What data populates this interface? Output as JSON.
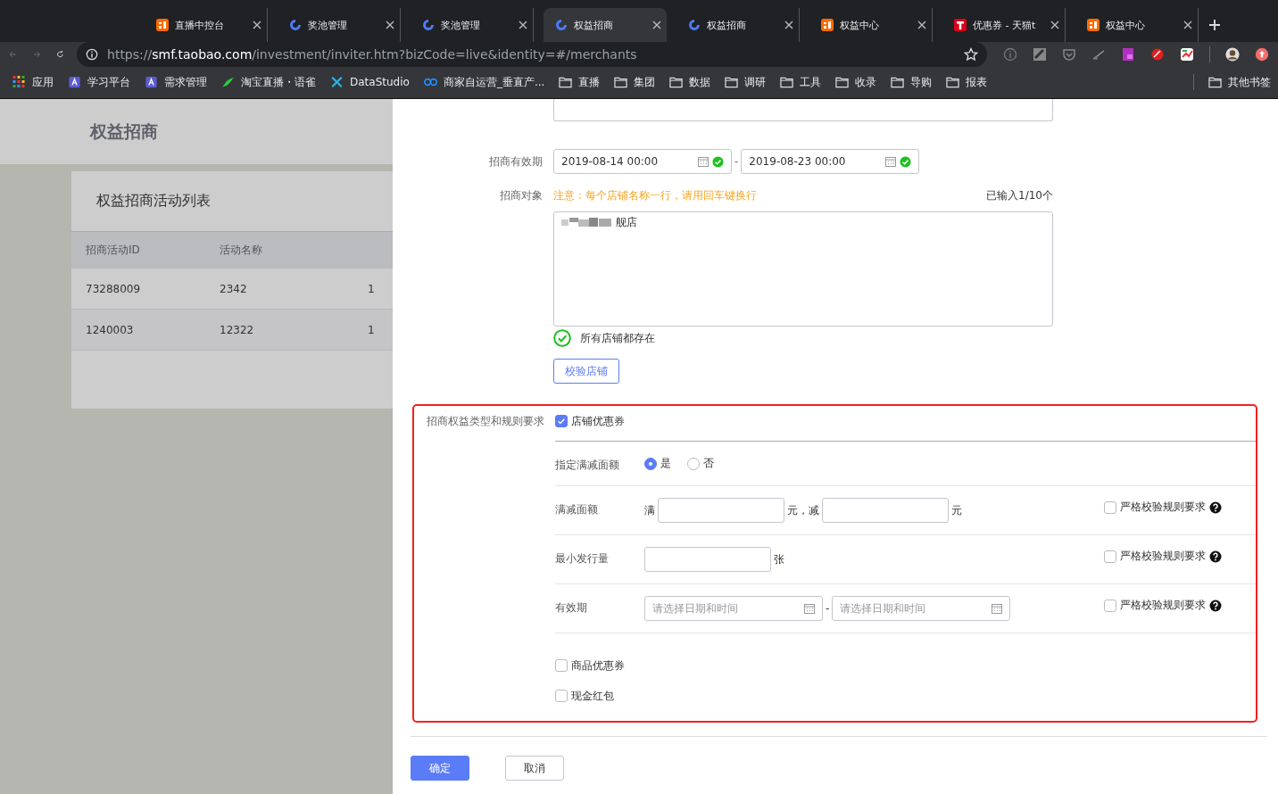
{
  "browser": {
    "tabs": [
      {
        "title": "直播中控台",
        "kind": "orange",
        "selected": false
      },
      {
        "title": "奖池管理",
        "kind": "swirl",
        "selected": false
      },
      {
        "title": "奖池管理",
        "kind": "swirl",
        "selected": false
      },
      {
        "title": "权益招商",
        "kind": "swirl",
        "selected": true
      },
      {
        "title": "权益招商",
        "kind": "swirl",
        "selected": false
      },
      {
        "title": "权益中心",
        "kind": "orange",
        "selected": false
      },
      {
        "title": "优惠券 - 天猫t",
        "kind": "red",
        "selected": false
      },
      {
        "title": "权益中心",
        "kind": "orange",
        "selected": false
      }
    ],
    "url": {
      "scheme": "https://",
      "host": "smf.taobao.com",
      "path": "/investment/inviter.htm?bizCode=live&identity=#/merchants"
    },
    "bookmarks": [
      {
        "label": "应用",
        "kind": "apps"
      },
      {
        "label": "学习平台",
        "kind": "site"
      },
      {
        "label": "需求管理",
        "kind": "site"
      },
      {
        "label": "淘宝直播・语雀",
        "kind": "bird"
      },
      {
        "label": "DataStudio",
        "kind": "tools"
      },
      {
        "label": "商家自运营_垂直产...",
        "kind": "link"
      },
      {
        "label": "直播",
        "kind": "folder"
      },
      {
        "label": "集团",
        "kind": "folder"
      },
      {
        "label": "数据",
        "kind": "folder"
      },
      {
        "label": "调研",
        "kind": "folder"
      },
      {
        "label": "工具",
        "kind": "folder"
      },
      {
        "label": "收录",
        "kind": "folder"
      },
      {
        "label": "导购",
        "kind": "folder"
      },
      {
        "label": "报表",
        "kind": "folder"
      }
    ],
    "other_bookmarks": "其他书签"
  },
  "page": {
    "title": "权益招商",
    "card": {
      "title": "权益招商活动列表",
      "columns": [
        "招商活动ID",
        "活动名称"
      ],
      "rows": [
        [
          "73288009",
          "2342",
          "1"
        ],
        [
          "1240003",
          "12322",
          "1"
        ]
      ]
    }
  },
  "drawer": {
    "validity": {
      "label": "招商有效期",
      "separator": "-",
      "start": {
        "value": "2019-08-14 00:00",
        "ok": true
      },
      "end": {
        "value": "2019-08-23 00:00",
        "ok": true
      }
    },
    "target": {
      "label": "招商对象",
      "note": "注意：每个店铺名称一行，请用回车键换行",
      "count": "已输入1/10个",
      "value": "舰店",
      "status": {
        "text": "所有店铺都存在",
        "ok": true
      },
      "verify_button": "校验店铺"
    },
    "benefits": {
      "label": "招商权益类型和规则要求",
      "highlighted": true,
      "options": [
        {
          "label": "店铺优惠券",
          "checked": true,
          "rules": [
            {
              "kind": "radio",
              "label": "指定满减面额",
              "choices": [
                {
                  "label": "是",
                  "selected": true
                },
                {
                  "label": "否",
                  "selected": false
                }
              ]
            },
            {
              "kind": "fields",
              "label": "满减面额",
              "segments": [
                {
                  "kind": "text",
                  "text": "满"
                },
                {
                  "kind": "input"
                },
                {
                  "kind": "text",
                  "text": "元，减"
                },
                {
                  "kind": "input"
                },
                {
                  "kind": "text",
                  "text": "元"
                }
              ],
              "strict": {
                "label": "严格校验规则要求",
                "checked": false
              }
            },
            {
              "kind": "fields",
              "label": "最小发行量",
              "segments": [
                {
                  "kind": "input"
                },
                {
                  "kind": "text",
                  "text": "张"
                }
              ],
              "strict": {
                "label": "严格校验规则要求",
                "checked": false
              }
            },
            {
              "kind": "fields",
              "label": "有效期",
              "segments": [
                {
                  "kind": "date",
                  "placeholder": "请选择日期和时间"
                },
                {
                  "kind": "text",
                  "text": "-"
                },
                {
                  "kind": "date",
                  "placeholder": "请选择日期和时间"
                }
              ],
              "strict": {
                "label": "严格校验规则要求",
                "checked": false
              }
            }
          ]
        },
        {
          "label": "商品优惠券",
          "checked": false
        },
        {
          "label": "现金红包",
          "checked": false
        }
      ]
    },
    "buttons": [
      {
        "label": "确定",
        "kind": "primary"
      },
      {
        "label": "取消",
        "kind": "default"
      }
    ]
  }
}
